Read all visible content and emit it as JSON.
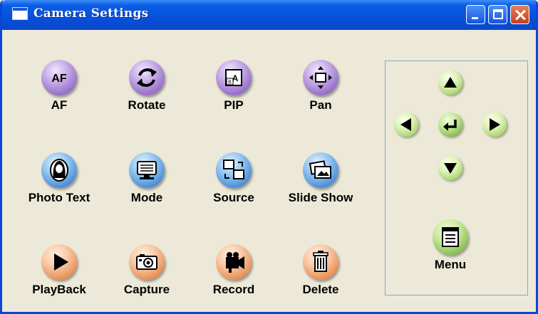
{
  "window": {
    "title": "Camera Settings",
    "controls": {
      "minimize": "minimize-icon",
      "maximize": "maximize-icon",
      "close": "close-icon"
    }
  },
  "buttons": [
    {
      "label": "AF",
      "icon": "af-icon",
      "color": "purple"
    },
    {
      "label": "Rotate",
      "icon": "rotate-icon",
      "color": "purple"
    },
    {
      "label": "PIP",
      "icon": "pip-icon",
      "color": "purple"
    },
    {
      "label": "Pan",
      "icon": "pan-icon",
      "color": "purple"
    },
    {
      "label": "Photo Text",
      "icon": "photo-text-icon",
      "color": "blue"
    },
    {
      "label": "Mode",
      "icon": "monitor-icon",
      "color": "blue"
    },
    {
      "label": "Source",
      "icon": "source-icon",
      "color": "blue"
    },
    {
      "label": "Slide Show",
      "icon": "slideshow-icon",
      "color": "blue"
    },
    {
      "label": "PlayBack",
      "icon": "play-icon",
      "color": "orange"
    },
    {
      "label": "Capture",
      "icon": "camera-icon",
      "color": "orange"
    },
    {
      "label": "Record",
      "icon": "video-camera-icon",
      "color": "orange"
    },
    {
      "label": "Delete",
      "icon": "trash-icon",
      "color": "orange"
    }
  ],
  "navigation": {
    "up": "arrow-up-icon",
    "left": "arrow-left-icon",
    "enter": "enter-icon",
    "right": "arrow-right-icon",
    "down": "arrow-down-icon",
    "menu_label": "Menu",
    "menu_icon": "menu-icon"
  },
  "colors": {
    "purple": "#8a5fc0",
    "blue": "#3a7fcf",
    "orange": "#e5803f",
    "green": "#78b63b",
    "title_bar": "#0650da",
    "background": "#ece9d8"
  }
}
